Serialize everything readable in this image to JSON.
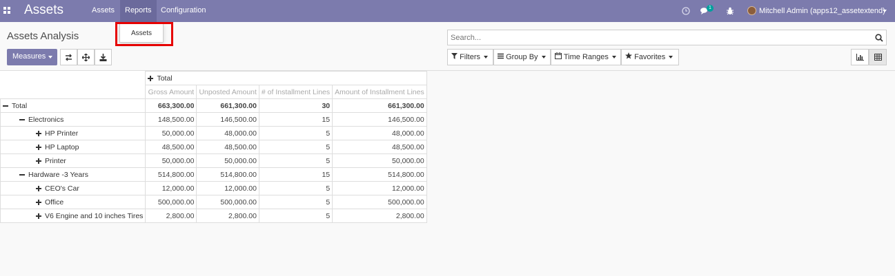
{
  "app": {
    "title": "Assets"
  },
  "menu": [
    {
      "label": "Assets"
    },
    {
      "label": "Reports"
    },
    {
      "label": "Configuration"
    }
  ],
  "systray": {
    "messages_badge": "1",
    "user_name": "Mitchell Admin (apps12_assetextend)"
  },
  "reports_dropdown": {
    "items": [
      {
        "label": "Assets"
      }
    ]
  },
  "page": {
    "title": "Assets Analysis"
  },
  "toolbar": {
    "measures_label": "Measures"
  },
  "search": {
    "placeholder": "Search..."
  },
  "filters": {
    "filters_label": "Filters",
    "group_by_label": "Group By",
    "time_ranges_label": "Time Ranges",
    "favorites_label": "Favorites"
  },
  "pivot": {
    "col_group": "Total",
    "columns": [
      "Gross Amount",
      "Unposted Amount",
      "# of Installment Lines",
      "Amount of Installment Lines"
    ],
    "rows": [
      {
        "label": "Total",
        "level": 0,
        "toggle": "minus",
        "bold": true,
        "values": [
          "663,300.00",
          "661,300.00",
          "30",
          "661,300.00"
        ]
      },
      {
        "label": "Electronics",
        "level": 1,
        "toggle": "minus",
        "bold": false,
        "values": [
          "148,500.00",
          "146,500.00",
          "15",
          "146,500.00"
        ]
      },
      {
        "label": "HP Printer",
        "level": 2,
        "toggle": "plus",
        "bold": false,
        "values": [
          "50,000.00",
          "48,000.00",
          "5",
          "48,000.00"
        ]
      },
      {
        "label": "HP Laptop",
        "level": 2,
        "toggle": "plus",
        "bold": false,
        "values": [
          "48,500.00",
          "48,500.00",
          "5",
          "48,500.00"
        ]
      },
      {
        "label": "Printer",
        "level": 2,
        "toggle": "plus",
        "bold": false,
        "values": [
          "50,000.00",
          "50,000.00",
          "5",
          "50,000.00"
        ]
      },
      {
        "label": "Hardware -3 Years",
        "level": 1,
        "toggle": "minus",
        "bold": false,
        "values": [
          "514,800.00",
          "514,800.00",
          "15",
          "514,800.00"
        ]
      },
      {
        "label": "CEO's Car",
        "level": 2,
        "toggle": "plus",
        "bold": false,
        "values": [
          "12,000.00",
          "12,000.00",
          "5",
          "12,000.00"
        ]
      },
      {
        "label": "Office",
        "level": 2,
        "toggle": "plus",
        "bold": false,
        "values": [
          "500,000.00",
          "500,000.00",
          "5",
          "500,000.00"
        ]
      },
      {
        "label": "V6 Engine and 10 inches Tires",
        "level": 2,
        "toggle": "plus",
        "bold": false,
        "values": [
          "2,800.00",
          "2,800.00",
          "5",
          "2,800.00"
        ]
      }
    ]
  }
}
